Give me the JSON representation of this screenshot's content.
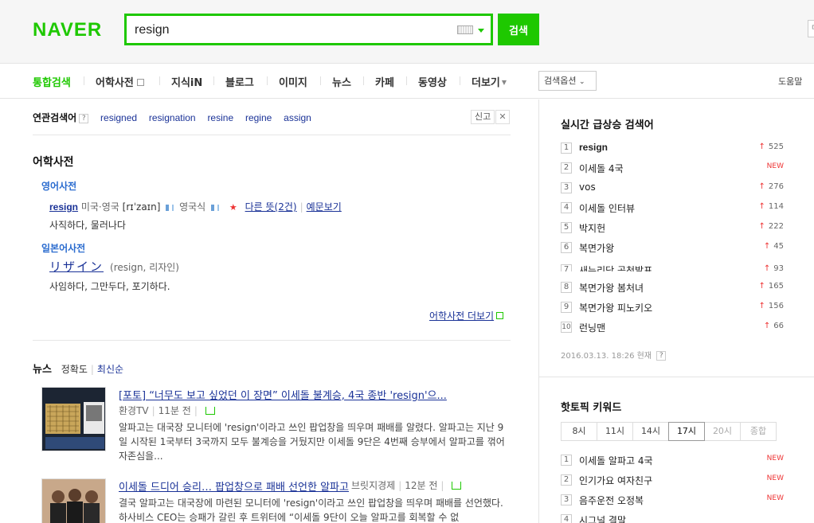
{
  "header": {
    "logo": "NAVER",
    "search_value": "resign",
    "search_button": "검색",
    "edge_box": "ㅁ"
  },
  "nav": {
    "tabs": [
      {
        "label": "통합검색",
        "active": true
      },
      {
        "label": "어학사전"
      },
      {
        "label": "지식iN"
      },
      {
        "label": "블로그"
      },
      {
        "label": "이미지"
      },
      {
        "label": "뉴스"
      },
      {
        "label": "카페"
      },
      {
        "label": "동영상"
      },
      {
        "label": "더보기"
      }
    ],
    "search_options": "검색옵션",
    "help": "도움말"
  },
  "related": {
    "title": "연관검색어",
    "help_mark": "?",
    "keywords": [
      "resigned",
      "resignation",
      "resine",
      "regine",
      "assign"
    ],
    "report": "신고",
    "close": "✕"
  },
  "dictionary": {
    "section_title": "어학사전",
    "english": {
      "label": "영어사전",
      "word": "resign",
      "us_label": "미국·영국",
      "pronunciation": "[rɪˈzaɪn]",
      "uk_label": "영국식",
      "other_meanings": "다른 뜻(2건)",
      "examples": "예문보기",
      "meaning": "사직하다, 물러나다"
    },
    "japanese": {
      "label": "일본어사전",
      "word": "リザイン",
      "reading": "(resign, 리자인)",
      "meaning": "사임하다, 그만두다, 포기하다."
    },
    "more": "어학사전 더보기"
  },
  "news": {
    "title": "뉴스",
    "sort_accuracy": "정확도",
    "sort_latest": "최신순",
    "items": [
      {
        "title": "[포토] “너무도 보고 싶었던 이 장면” 이세돌 불계승, 4국 종반 'resign'으...",
        "source": "환경TV",
        "time": "11분 전",
        "snippet": "알파고는 대국장 모니터에 'resign'이라고 쓰인 팝업창을 띄우며 패배를 알렸다. 알파고는 지난 9일 시작된 1국부터 3국까지 모두 불계승을 거뒀지만 이세돌 9단은 4번째 승부에서 알파고를 꺾어 자존심을..."
      },
      {
        "title": "이세돌 드디어 승리… 팝업창으로 패배 선언한 알파고",
        "source": "브릿지경제",
        "time": "12분 전",
        "snippet": "결국 알파고는 대국장에 마련된 모니터에 'resign'이라고 쓰인 팝업창을 띄우며 패배를 선언했다. 하사비스 CEO는 승패가 갈린 후 트위터에 “이세돌 9단이 오늘 알파고를 회복할 수 없"
      }
    ]
  },
  "realtime": {
    "title": "실시간 급상승 검색어",
    "items": [
      {
        "rank": "1",
        "keyword": "resign",
        "change": "525",
        "dir": "up"
      },
      {
        "rank": "2",
        "keyword": "이세돌 4국",
        "change": "NEW",
        "dir": "new"
      },
      {
        "rank": "3",
        "keyword": "vos",
        "change": "276",
        "dir": "up"
      },
      {
        "rank": "4",
        "keyword": "이세돌 인터뷰",
        "change": "114",
        "dir": "up"
      },
      {
        "rank": "5",
        "keyword": "박지헌",
        "change": "222",
        "dir": "up"
      },
      {
        "rank": "6",
        "keyword": "복면가왕",
        "change": "45",
        "dir": "up"
      },
      {
        "rank": "7",
        "keyword": "새누리당 공천발표",
        "change": "93",
        "dir": "up"
      },
      {
        "rank": "8",
        "keyword": "복면가왕 봄처녀",
        "change": "165",
        "dir": "up"
      },
      {
        "rank": "9",
        "keyword": "복면가왕 피노키오",
        "change": "156",
        "dir": "up"
      },
      {
        "rank": "10",
        "keyword": "런닝맨",
        "change": "66",
        "dir": "up"
      }
    ],
    "timestamp": "2016.03.13. 18:26 현재",
    "help_mark": "?"
  },
  "hot_topic": {
    "title": "핫토픽 키워드",
    "hours": [
      {
        "label": "8시"
      },
      {
        "label": "11시"
      },
      {
        "label": "14시"
      },
      {
        "label": "17시",
        "active": true
      },
      {
        "label": "20시",
        "disabled": true
      },
      {
        "label": "종합",
        "disabled": true
      }
    ],
    "items": [
      {
        "rank": "1",
        "keyword": "이세돌 알파고 4국",
        "change": "NEW"
      },
      {
        "rank": "2",
        "keyword": "인기가요 여자친구",
        "change": "NEW"
      },
      {
        "rank": "3",
        "keyword": "음주운전 오정복",
        "change": "NEW"
      },
      {
        "rank": "4",
        "keyword": "시그널 결말",
        "change": ""
      }
    ]
  },
  "colors": {
    "brand_green": "#1ec800",
    "link_blue": "#1a3297",
    "dict_label_blue": "#2b6ccf",
    "up_red": "#e33333"
  }
}
